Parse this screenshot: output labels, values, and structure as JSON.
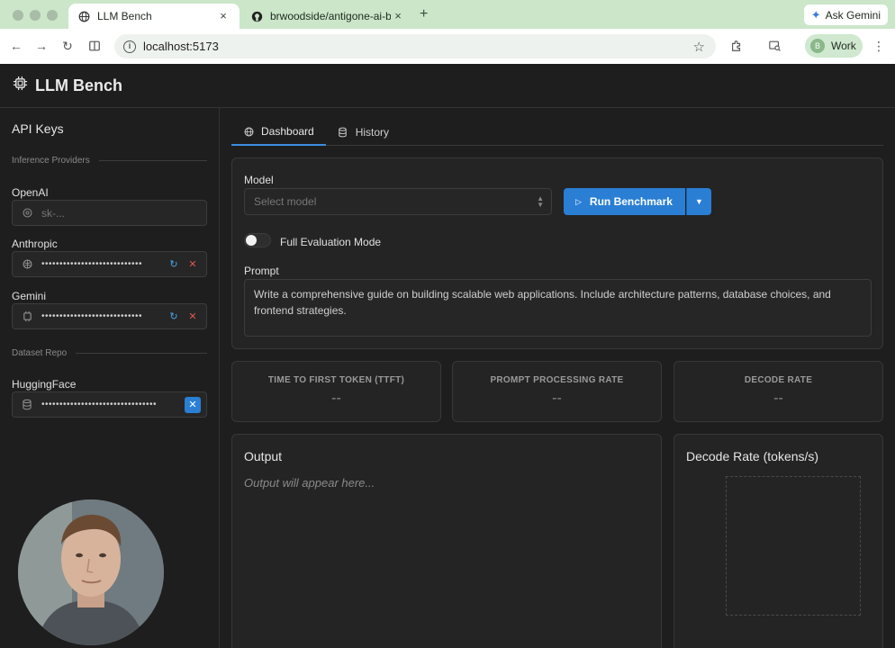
{
  "browser": {
    "tabs": [
      {
        "title": "LLM Bench",
        "close": "×"
      },
      {
        "title": "brwoodside/antigone-ai-benc",
        "close": "×"
      }
    ],
    "new_tab": "+",
    "ask_gemini": "Ask Gemini",
    "url": "localhost:5173",
    "profile_initial": "B",
    "profile_label": "Work"
  },
  "app": {
    "title": "LLM Bench"
  },
  "sidebar": {
    "title": "API Keys",
    "section_providers": "Inference Providers",
    "section_dataset": "Dataset Repo",
    "openai": {
      "label": "OpenAI",
      "placeholder": "sk-..."
    },
    "anthropic": {
      "label": "Anthropic",
      "masked": "••••••••••••••••••••••••••••"
    },
    "gemini": {
      "label": "Gemini",
      "masked": "••••••••••••••••••••••••••••"
    },
    "huggingface": {
      "label": "HuggingFace",
      "masked": "••••••••••••••••••••••••••••••••"
    }
  },
  "main": {
    "tabs": [
      {
        "label": "Dashboard",
        "icon": "gauge-icon",
        "active": true
      },
      {
        "label": "History",
        "icon": "database-icon",
        "active": false
      }
    ],
    "model_label": "Model",
    "model_placeholder": "Select model",
    "run_button": "Run Benchmark",
    "full_eval_label": "Full Evaluation Mode",
    "prompt_label": "Prompt",
    "prompt_text": "Write a comprehensive guide on building scalable web applications. Include architecture patterns, database choices, and frontend strategies.",
    "stats": [
      {
        "label": "TIME TO FIRST TOKEN (TTFT)",
        "value": "--"
      },
      {
        "label": "PROMPT PROCESSING RATE",
        "value": "--"
      },
      {
        "label": "DECODE RATE",
        "value": "--"
      }
    ],
    "output_title": "Output",
    "output_placeholder": "Output will appear here...",
    "chart_title": "Decode Rate (tokens/s)"
  },
  "colors": {
    "accent": "#2a7fd4",
    "danger": "#e05454",
    "refresh": "#4aa3e6",
    "chrome": "#cfe8cf"
  }
}
